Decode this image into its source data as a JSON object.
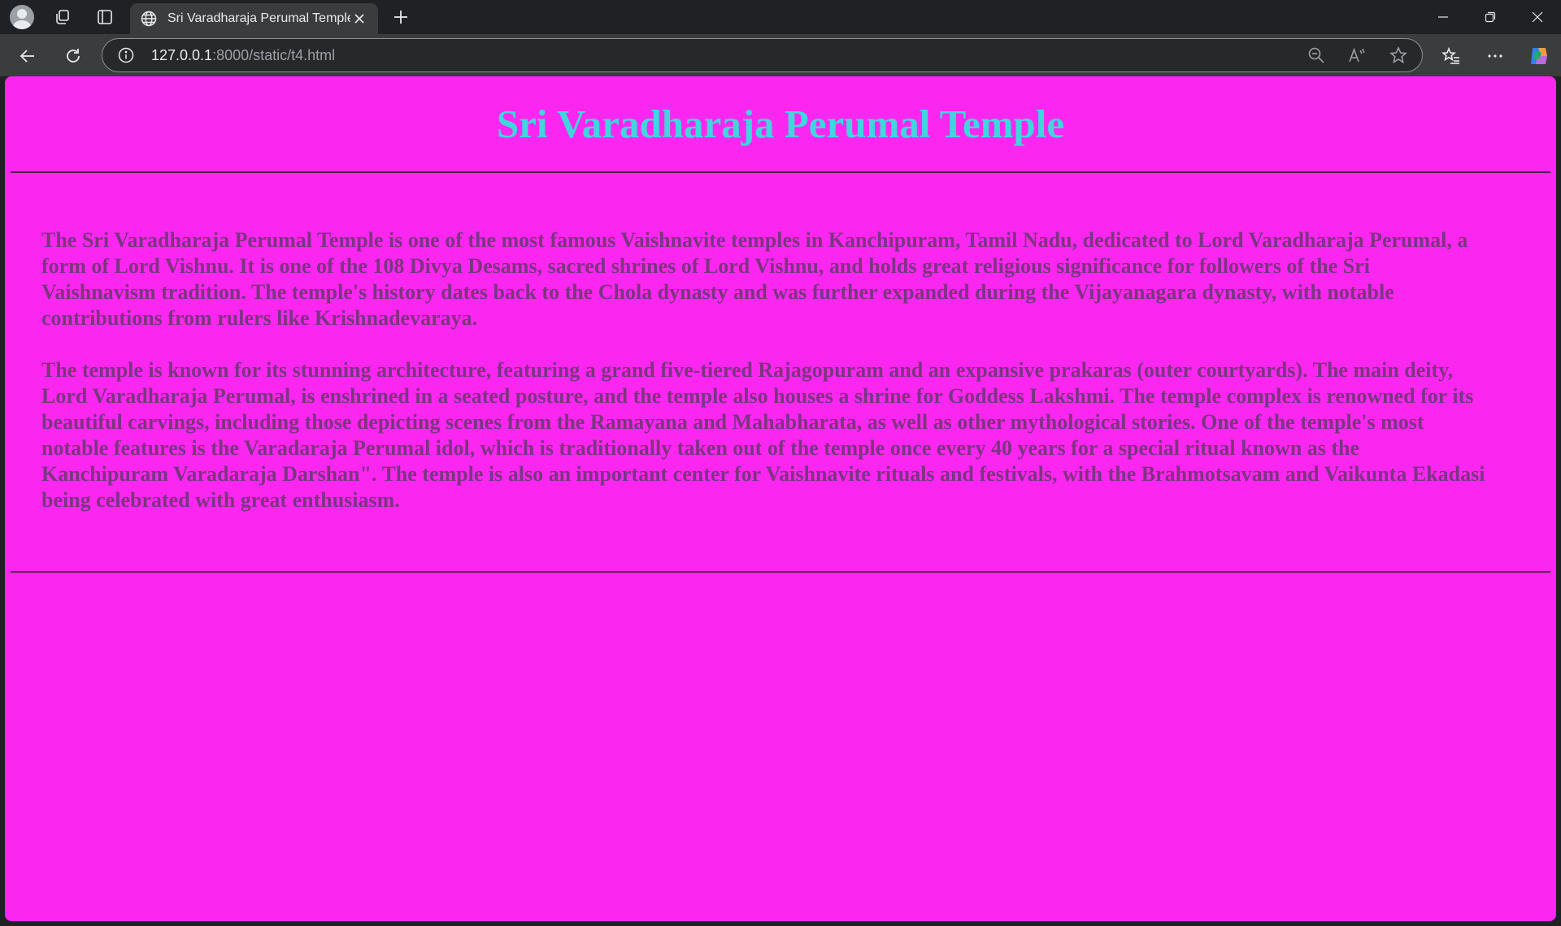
{
  "browser": {
    "tab_title": "Sri Varadharaja Perumal Temple",
    "url_host": "127.0.0.1",
    "url_rest": ":8000/static/t4.html",
    "icons": [
      "profile-avatar",
      "workspaces-icon",
      "tab-actions-icon",
      "globe-icon",
      "close-icon",
      "new-tab-icon",
      "minimize-icon",
      "restore-icon",
      "close-window-icon",
      "back-icon",
      "refresh-icon",
      "info-icon",
      "zoom-out-icon",
      "read-aloud-icon",
      "favorite-star-icon",
      "favorites-icon",
      "more-icon",
      "copilot-icon"
    ]
  },
  "page": {
    "background": "#fb27f0",
    "heading": "Sri Varadharaja Perumal Temple",
    "heading_color": "#3fd6dd",
    "text_color": "#7b3581",
    "paragraphs": [
      "The Sri Varadharaja Perumal Temple is one of the most famous Vaishnavite temples in Kanchipuram, Tamil Nadu, dedicated to Lord Varadharaja Perumal, a form of Lord Vishnu. It is one of the 108 Divya Desams, sacred shrines of Lord Vishnu, and holds great religious significance for followers of the Sri Vaishnavism tradition. The temple's history dates back to the Chola dynasty and was further expanded during the Vijayanagara dynasty, with notable contributions from rulers like Krishnadevaraya.",
      "The temple is known for its stunning architecture, featuring a grand five-tiered Rajagopuram and an expansive prakaras (outer courtyards). The main deity, Lord Varadharaja Perumal, is enshrined in a seated posture, and the temple also houses a shrine for Goddess Lakshmi. The temple complex is renowned for its beautiful carvings, including those depicting scenes from the Ramayana and Mahabharata, as well as other mythological stories. One of the temple's most notable features is the Varadaraja Perumal idol, which is traditionally taken out of the temple once every 40 years for a special ritual known as the Kanchipuram Varadaraja Darshan\". The temple is also an important center for Vaishnavite rituals and festivals, with the Brahmotsavam and Vaikunta Ekadasi being celebrated with great enthusiasm."
    ]
  }
}
